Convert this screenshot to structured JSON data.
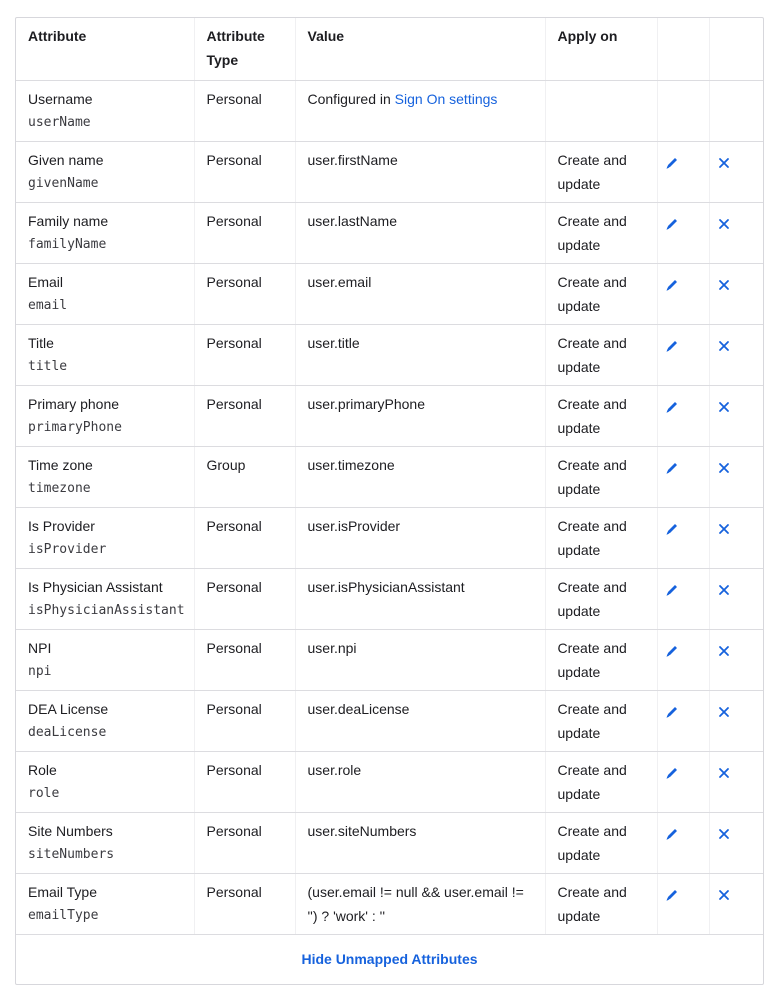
{
  "colors": {
    "accent": "#1662dd",
    "border": "#d7d7dc",
    "text": "#1d1d21"
  },
  "headers": {
    "attribute": "Attribute",
    "attribute_type": "Attribute Type",
    "value": "Value",
    "apply_on": "Apply on"
  },
  "rows": [
    {
      "label": "Username",
      "var": "userName",
      "type": "Personal",
      "value_prefix": "Configured in ",
      "value_link": "Sign On settings",
      "value": "",
      "apply_on": "",
      "editable": false
    },
    {
      "label": "Given name",
      "var": "givenName",
      "type": "Personal",
      "value": "user.firstName",
      "apply_on": "Create and update",
      "editable": true
    },
    {
      "label": "Family name",
      "var": "familyName",
      "type": "Personal",
      "value": "user.lastName",
      "apply_on": "Create and update",
      "editable": true
    },
    {
      "label": "Email",
      "var": "email",
      "type": "Personal",
      "value": "user.email",
      "apply_on": "Create and update",
      "editable": true
    },
    {
      "label": "Title",
      "var": "title",
      "type": "Personal",
      "value": "user.title",
      "apply_on": "Create and update",
      "editable": true
    },
    {
      "label": "Primary phone",
      "var": "primaryPhone",
      "type": "Personal",
      "value": "user.primaryPhone",
      "apply_on": "Create and update",
      "editable": true
    },
    {
      "label": "Time zone",
      "var": "timezone",
      "type": "Group",
      "value": "user.timezone",
      "apply_on": "Create and update",
      "editable": true
    },
    {
      "label": "Is Provider",
      "var": "isProvider",
      "type": "Personal",
      "value": "user.isProvider",
      "apply_on": "Create and update",
      "editable": true
    },
    {
      "label": "Is Physician Assistant",
      "var": "isPhysicianAssistant",
      "type": "Personal",
      "value": "user.isPhysicianAssistant",
      "apply_on": "Create and update",
      "editable": true
    },
    {
      "label": "NPI",
      "var": "npi",
      "type": "Personal",
      "value": "user.npi",
      "apply_on": "Create and update",
      "editable": true
    },
    {
      "label": "DEA License",
      "var": "deaLicense",
      "type": "Personal",
      "value": "user.deaLicense",
      "apply_on": "Create and update",
      "editable": true
    },
    {
      "label": "Role",
      "var": "role",
      "type": "Personal",
      "value": "user.role",
      "apply_on": "Create and update",
      "editable": true
    },
    {
      "label": "Site Numbers",
      "var": "siteNumbers",
      "type": "Personal",
      "value": "user.siteNumbers",
      "apply_on": "Create and update",
      "editable": true
    },
    {
      "label": "Email Type",
      "var": "emailType",
      "type": "Personal",
      "value": "(user.email != null && user.email != '') ? 'work' : ''",
      "apply_on": "Create and update",
      "editable": true
    }
  ],
  "icons": {
    "edit": "pencil-icon",
    "remove": "close-icon"
  },
  "footer": {
    "toggle_label": "Hide Unmapped Attributes"
  }
}
